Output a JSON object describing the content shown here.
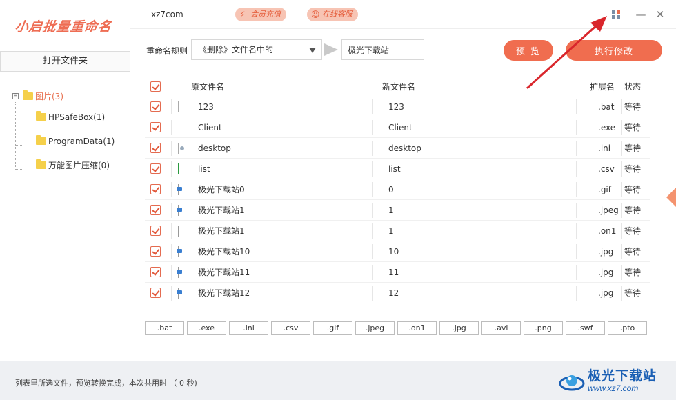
{
  "app": {
    "logo_text": "小启批量重命名",
    "site": "xz7com",
    "vip_label": "会员充值",
    "service_label": "在线客服"
  },
  "sidebar": {
    "open_folder_label": "打开文件夹",
    "tree": {
      "root_toggle": "⊟",
      "root_label": "图片(3)",
      "children": [
        {
          "label": "HPSafeBox(1)"
        },
        {
          "label": "ProgramData(1)"
        },
        {
          "label": "万能图片压缩(0)"
        }
      ]
    }
  },
  "rule": {
    "label": "重命名规则",
    "select_value": "《删除》文件名中的",
    "input_value": "极光下载站",
    "preview_label": "预 览",
    "execute_label": "执行修改"
  },
  "table": {
    "headers": {
      "original": "原文件名",
      "new": "新文件名",
      "ext": "扩展名",
      "status": "状态"
    },
    "rows": [
      {
        "icon": "bat-file-icon",
        "original": "123",
        "new": "123",
        "ext": ".bat",
        "status": "等待"
      },
      {
        "icon": "shield-file-icon",
        "original": "Client",
        "new": "Client",
        "ext": ".exe",
        "status": "等待"
      },
      {
        "icon": "ini-file-icon",
        "original": "desktop",
        "new": "desktop",
        "ext": ".ini",
        "status": "等待"
      },
      {
        "icon": "csv-file-icon",
        "original": "list",
        "new": "list",
        "ext": ".csv",
        "status": "等待"
      },
      {
        "icon": "image-file-icon",
        "original": "极光下载站0",
        "new": "0",
        "ext": ".gif",
        "status": "等待"
      },
      {
        "icon": "image-file-icon",
        "original": "极光下载站1",
        "new": "1",
        "ext": ".jpeg",
        "status": "等待"
      },
      {
        "icon": "blank-file-icon",
        "original": "极光下载站1",
        "new": "1",
        "ext": ".on1",
        "status": "等待"
      },
      {
        "icon": "image-file-icon",
        "original": "极光下载站10",
        "new": "10",
        "ext": ".jpg",
        "status": "等待"
      },
      {
        "icon": "image-file-icon",
        "original": "极光下载站11",
        "new": "11",
        "ext": ".jpg",
        "status": "等待"
      },
      {
        "icon": "image-file-icon",
        "original": "极光下载站12",
        "new": "12",
        "ext": ".jpg",
        "status": "等待"
      }
    ]
  },
  "ext_filters": [
    ".bat",
    ".exe",
    ".ini",
    ".csv",
    ".gif",
    ".jpeg",
    ".on1",
    ".jpg",
    ".avi",
    ".png",
    ".swf",
    ".pto"
  ],
  "status_bar": {
    "text": "列表里所选文件，预览转换完成，本次共用时 （ 0 秒)"
  },
  "watermark": {
    "title": "极光下载站",
    "url": "www.xz7.com"
  },
  "colors": {
    "accent": "#f06d4f",
    "pill_bg": "#f7c4b4",
    "annotation_arrow": "#d9262c",
    "watermark_blue": "#1a5fb4"
  }
}
